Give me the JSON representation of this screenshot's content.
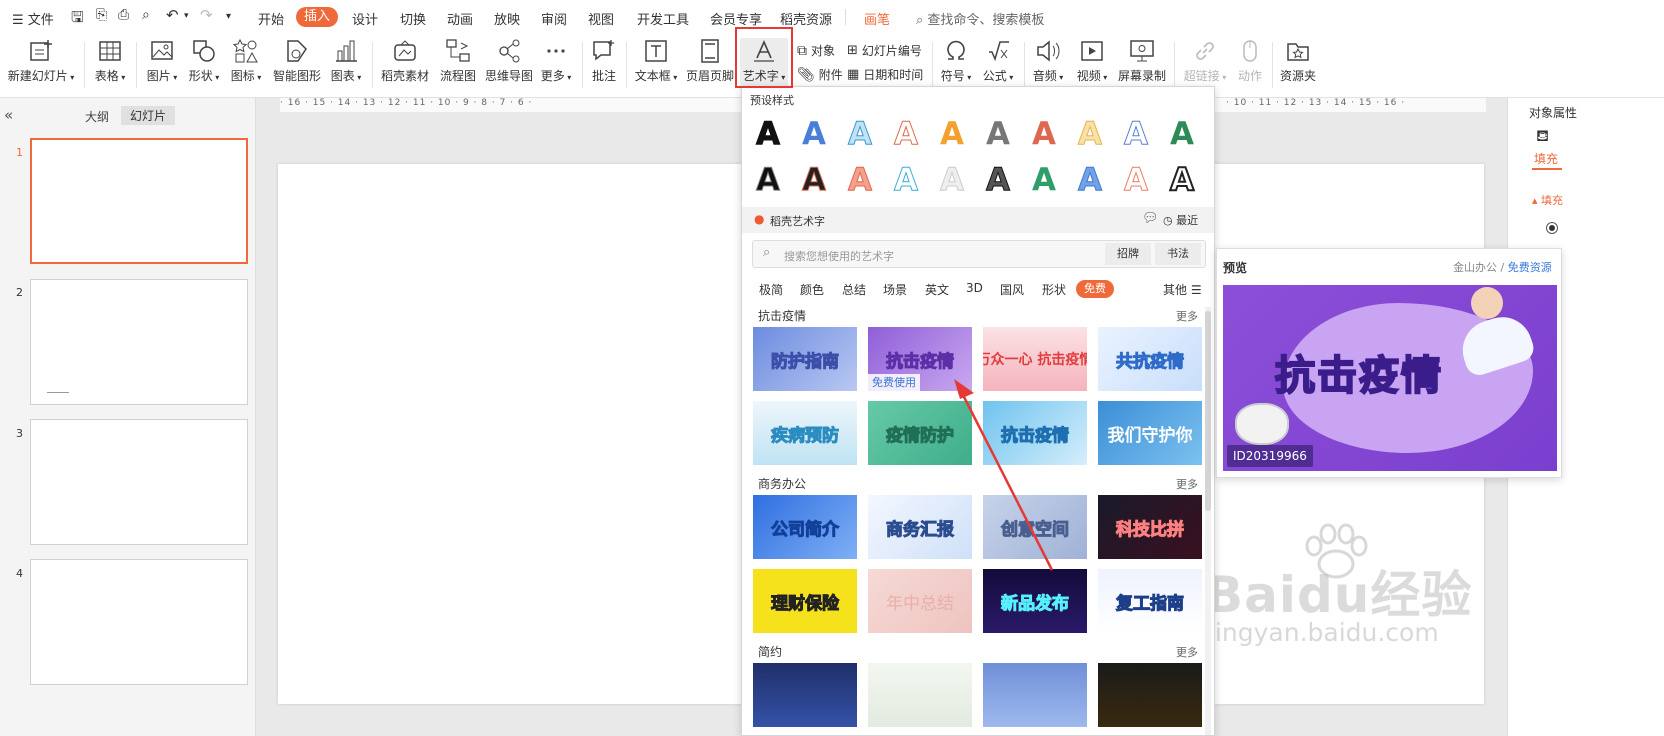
{
  "menubar": {
    "file": "文件",
    "tabs": [
      "开始",
      "插入",
      "设计",
      "切换",
      "动画",
      "放映",
      "审阅",
      "视图",
      "开发工具",
      "会员专享",
      "稻壳资源"
    ],
    "pen": "画笔",
    "search": "查找命令、搜索模板"
  },
  "ribbon": {
    "new_slide": "新建幻灯片",
    "table": "表格",
    "picture": "图片",
    "shape": "形状",
    "icon": "图标",
    "smart_shape": "智能图形",
    "chart": "图表",
    "docer_material": "稻壳素材",
    "flowchart": "流程图",
    "mindmap": "思维导图",
    "more": "更多",
    "comment": "批注",
    "textbox": "文本框",
    "header_footer": "页眉页脚",
    "wordart": "艺术字",
    "object": "对象",
    "attachment": "附件",
    "slide_number": "幻灯片编号",
    "datetime": "日期和时间",
    "symbol": "符号",
    "formula": "公式",
    "audio": "音频",
    "video": "视频",
    "screen_record": "屏幕录制",
    "hyperlink": "超链接",
    "action": "动作",
    "resource_folder": "资源夹"
  },
  "left_panel": {
    "collapse": "«",
    "outline": "大纲",
    "slides": "幻灯片",
    "slide_numbers": [
      "1",
      "2",
      "3",
      "4"
    ]
  },
  "ruler_left": "· 16 · 15 · 14 · 13 · 12 · 11 · 10 · 9 · 8 · 7 · 6 ·",
  "ruler_right": "· 10 · 11 · 12 · 13 · 14 · 15 · 16 ·",
  "wordart_panel": {
    "preset_title": "预设样式",
    "docer_title": "稻壳艺术字",
    "recent": "最近",
    "search_placeholder": "搜索您想使用的艺术字",
    "btn_signboard": "招牌",
    "btn_calligraphy": "书法",
    "filters": [
      "极简",
      "颜色",
      "总结",
      "场景",
      "英文",
      "3D",
      "国风",
      "形状"
    ],
    "filter_active": "免费",
    "filter_others": "其他",
    "sections": [
      {
        "title": "抗击疫情",
        "more": "更多",
        "tiles": [
          "防护指南",
          "抗击疫情",
          "万众一心 抗击疫情",
          "共抗疫情",
          "疾病预防",
          "疫情防护",
          "抗击疫情",
          "我们守护你"
        ],
        "free_tag": "免费使用"
      },
      {
        "title": "商务办公",
        "more": "更多",
        "tiles": [
          "公司简介",
          "商务汇报",
          "创意空间",
          "科技比拼",
          "理财保险",
          "年中总结",
          "新品发布",
          "复工指南"
        ]
      },
      {
        "title": "简约",
        "more": "更多"
      }
    ]
  },
  "preview": {
    "title": "预览",
    "source": "金山办公 / ",
    "source_link": "免费资源",
    "art_text": "抗击疫情",
    "id": "ID20319966"
  },
  "right_panel": {
    "title": "对象属性",
    "fill_tab": "填充",
    "fill_section": "填充"
  },
  "watermark": {
    "brand": "Baidu经验",
    "url": "jingyan.baidu.com"
  },
  "colors": {
    "accent": "#ef6a3b",
    "highlight": "#e53935",
    "slide_selected": "#ef6a3b"
  }
}
